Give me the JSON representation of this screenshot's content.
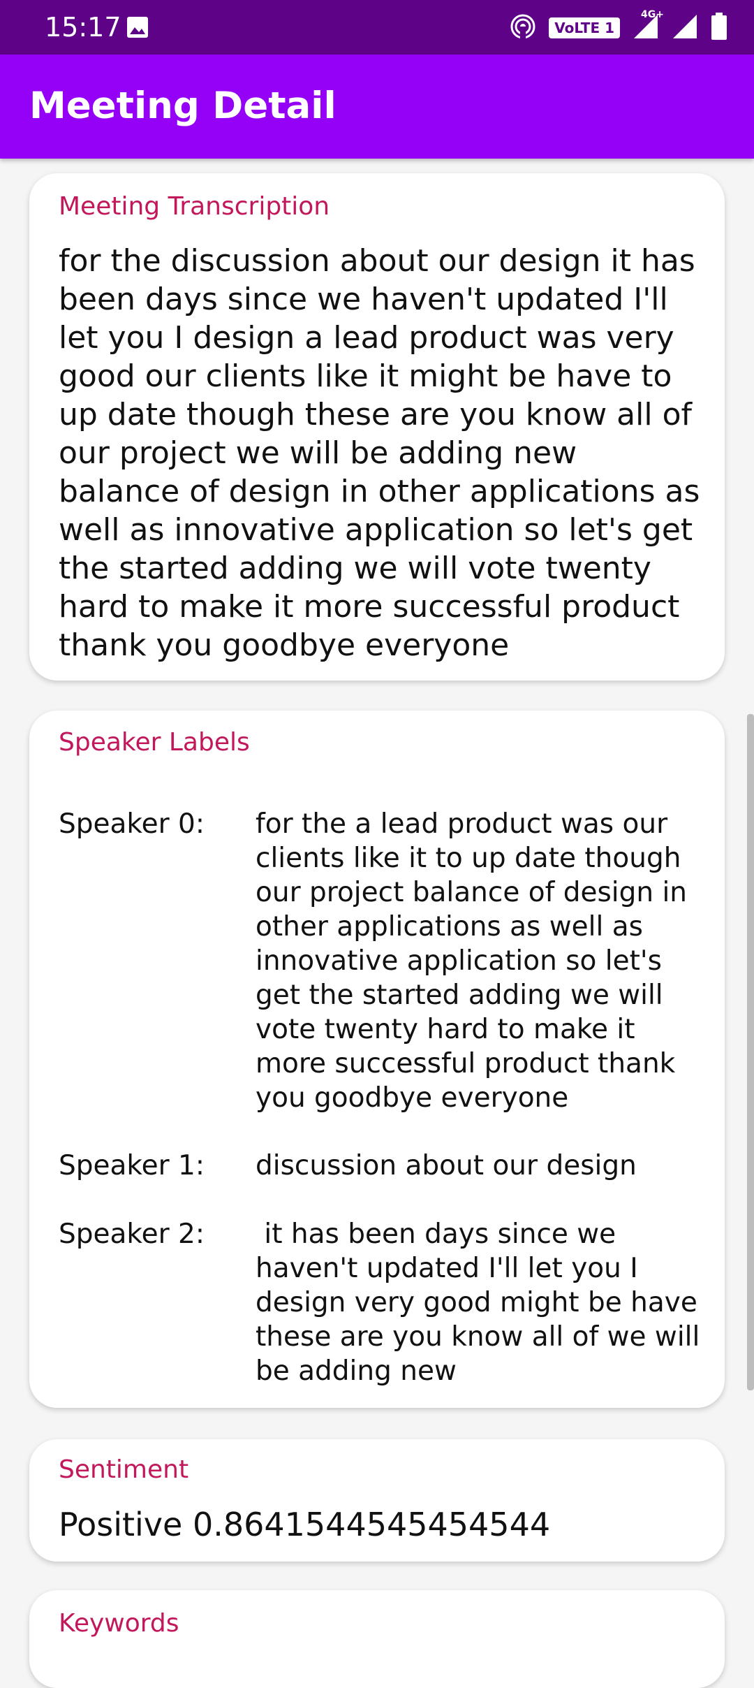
{
  "status": {
    "time": "15:17",
    "network": "VoLTE 1",
    "network_type": "4G+",
    "icons": [
      "image-icon",
      "hotspot-icon",
      "signal-icon",
      "signal-icon-2",
      "battery-icon"
    ]
  },
  "appbar": {
    "title": "Meeting Detail"
  },
  "transcription": {
    "label": "Meeting Transcription",
    "text": "for the discussion about our design it has been days since we haven't updated I'll let you I design a lead product was very good our clients like it might be have to up date though these are you know all of our project we will be adding new balance of design in other applications as well as innovative application so let's get the started adding we will vote twenty hard to make it more successful product thank you goodbye everyone"
  },
  "speakers": {
    "label": "Speaker Labels",
    "items": [
      {
        "name": "Speaker 0:",
        "text": "for the a lead product was our clients like it to up date though our project balance of design in other applications as well as innovative application so let's get the started adding we will vote twenty hard to make it more successful product thank you goodbye everyone"
      },
      {
        "name": "Speaker 1:",
        "text": "discussion about our design"
      },
      {
        "name": "Speaker 2:",
        "text": " it has been days since we haven't updated I'll let you I design very good might be have these are you know all of we will be adding new"
      }
    ]
  },
  "sentiment": {
    "label": "Sentiment",
    "value": "Positive 0.8641544545454544"
  },
  "keywords": {
    "label": "Keywords"
  },
  "colors": {
    "status_bar": "#5e0287",
    "app_bar": "#9500f7",
    "label_accent": "#c2185b",
    "background": "#f5f5f5"
  }
}
